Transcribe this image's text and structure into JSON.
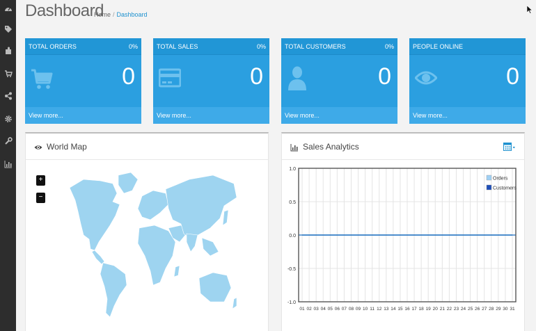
{
  "header": {
    "title": "Dashboard"
  },
  "breadcrumb": {
    "home": "Home",
    "separator": "/",
    "current": "Dashboard"
  },
  "sidebar": {
    "items": [
      {
        "icon": "dashboard-icon"
      },
      {
        "icon": "tags-icon"
      },
      {
        "icon": "puzzle-icon"
      },
      {
        "icon": "shopping-cart-icon"
      },
      {
        "icon": "share-icon"
      },
      {
        "icon": "cog-icon"
      },
      {
        "icon": "wrench-icon"
      },
      {
        "icon": "bar-chart-icon"
      }
    ]
  },
  "tiles": [
    {
      "label": "TOTAL ORDERS",
      "percent": "0%",
      "value": "0",
      "link": "View more...",
      "icon": "shopping-cart-icon"
    },
    {
      "label": "TOTAL SALES",
      "percent": "0%",
      "value": "0",
      "link": "View more...",
      "icon": "credit-card-icon"
    },
    {
      "label": "TOTAL CUSTOMERS",
      "percent": "0%",
      "value": "0",
      "link": "View more...",
      "icon": "user-icon"
    },
    {
      "label": "PEOPLE ONLINE",
      "percent": "",
      "value": "0",
      "link": "View more...",
      "icon": "eye-icon"
    }
  ],
  "world_map": {
    "title": "World Map",
    "zoom_in": "+",
    "zoom_out": "−",
    "icon": "eye-icon"
  },
  "sales_analytics": {
    "title": "Sales Analytics",
    "icon": "bar-chart-icon",
    "range_icon": "calendar-icon"
  },
  "colors": {
    "sidebar": "#2d2d2d",
    "tile": "#2b9fe0",
    "map_land": "#9ed4f0",
    "orders": "#9fd0f4",
    "customers": "#1f4fb8",
    "line": "#1f6fc0"
  },
  "chart_data": {
    "type": "line",
    "title": "Sales Analytics",
    "x": [
      "01",
      "02",
      "03",
      "04",
      "05",
      "06",
      "07",
      "08",
      "09",
      "10",
      "11",
      "12",
      "13",
      "14",
      "15",
      "16",
      "17",
      "18",
      "19",
      "20",
      "21",
      "22",
      "23",
      "24",
      "25",
      "26",
      "27",
      "28",
      "29",
      "30",
      "31"
    ],
    "series": [
      {
        "name": "Orders",
        "values": [
          0,
          0,
          0,
          0,
          0,
          0,
          0,
          0,
          0,
          0,
          0,
          0,
          0,
          0,
          0,
          0,
          0,
          0,
          0,
          0,
          0,
          0,
          0,
          0,
          0,
          0,
          0,
          0,
          0,
          0,
          0
        ]
      },
      {
        "name": "Customers",
        "values": [
          0,
          0,
          0,
          0,
          0,
          0,
          0,
          0,
          0,
          0,
          0,
          0,
          0,
          0,
          0,
          0,
          0,
          0,
          0,
          0,
          0,
          0,
          0,
          0,
          0,
          0,
          0,
          0,
          0,
          0,
          0
        ]
      }
    ],
    "yticks": [
      "1.0",
      "0.5",
      "0.0",
      "-0.5",
      "-1.0"
    ],
    "ylim": [
      -1,
      1
    ],
    "grid": true,
    "legend": "top-right"
  }
}
